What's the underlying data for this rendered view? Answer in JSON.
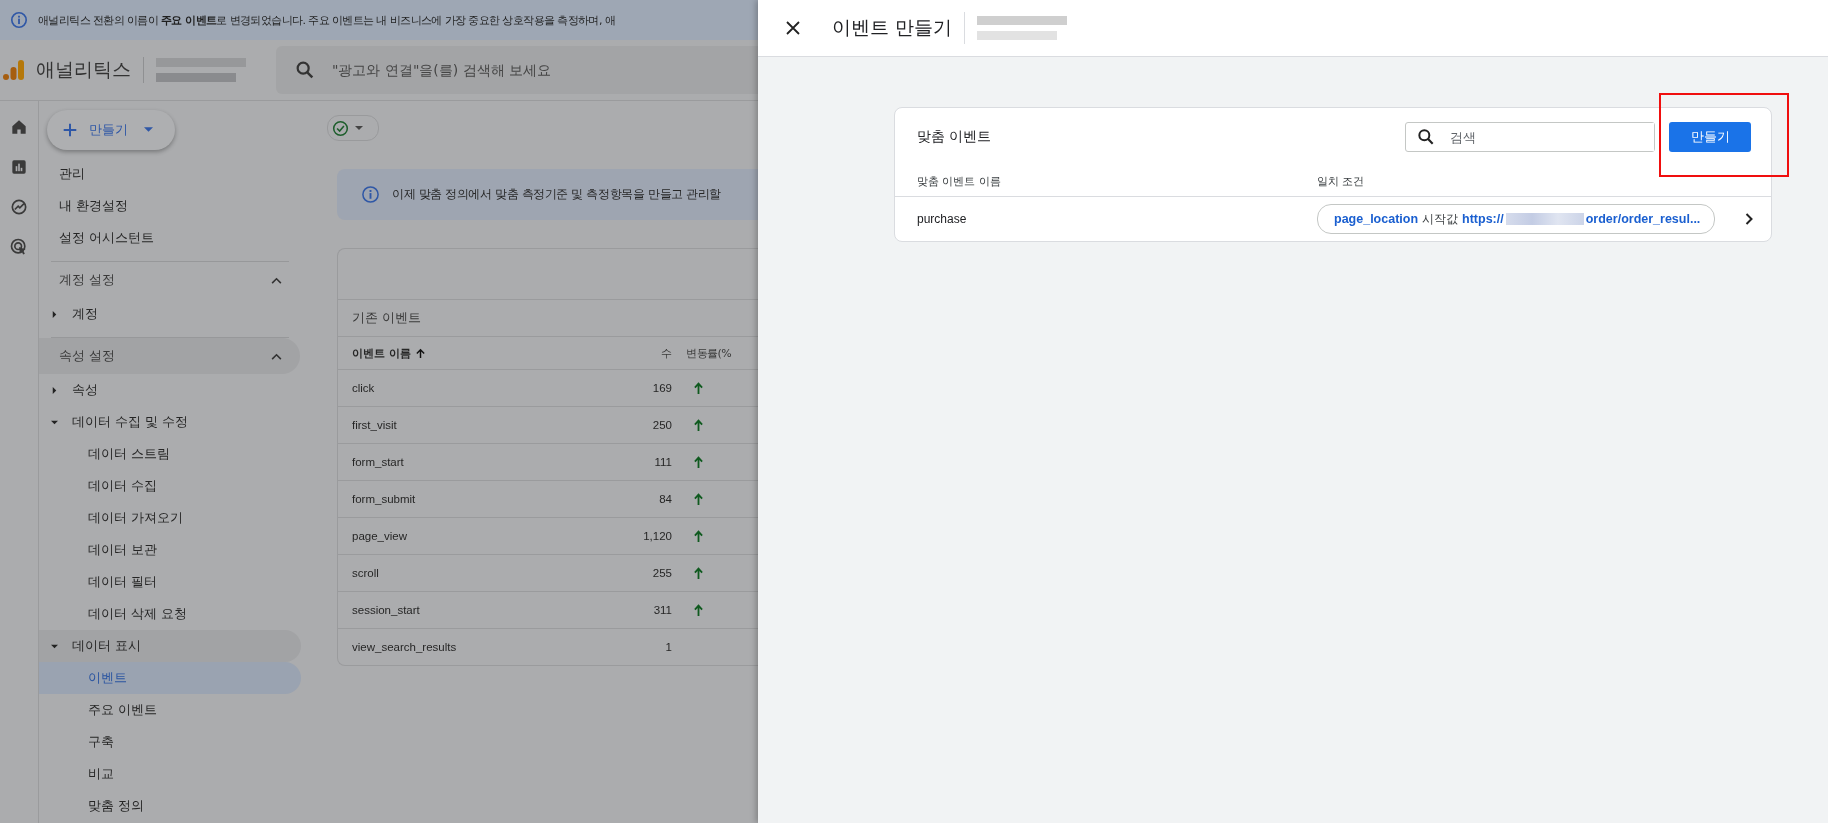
{
  "banner": {
    "text": "애널리틱스 전환의 이름이 **주요 이벤트**로 변경되었습니다. 주요 이벤트는 내 비즈니스에 가장 중요한 상호작용을 측정하며, 애"
  },
  "app_bar": {
    "product": "애널리틱스",
    "search_placeholder": "\"광고와 연결\"을(를) 검색해 보세요"
  },
  "create_button": "만들기",
  "sidebar": {
    "top_items": [
      "관리",
      "내 환경설정",
      "설정 어시스턴트"
    ],
    "sections": [
      {
        "title": "계정 설정",
        "expanded": true,
        "items": [
          {
            "label": "계정",
            "expanded": false
          }
        ]
      },
      {
        "title": "속성 설정",
        "expanded": true,
        "items": [
          {
            "label": "속성",
            "expanded": false
          },
          {
            "label": "데이터 수집 및 수정",
            "expanded": true,
            "children": [
              {
                "label": "데이터 스트림",
                "selected": false
              },
              {
                "label": "데이터 수집",
                "selected": false
              },
              {
                "label": "데이터 가져오기",
                "selected": false
              },
              {
                "label": "데이터 보관",
                "selected": false
              },
              {
                "label": "데이터 필터",
                "selected": false
              },
              {
                "label": "데이터 삭제 요청",
                "selected": false
              }
            ]
          },
          {
            "label": "데이터 표시",
            "expanded": true,
            "children": [
              {
                "label": "이벤트",
                "selected": true
              },
              {
                "label": "주요 이벤트",
                "selected": false
              },
              {
                "label": "구축",
                "selected": false
              },
              {
                "label": "비교",
                "selected": false
              },
              {
                "label": "맞춤 정의",
                "selected": false
              }
            ]
          }
        ]
      }
    ]
  },
  "info_message": "이제 맞춤 정의에서 맞춤 측정기준 및 측정항목을 만들고 관리할",
  "events_table": {
    "title": "기존 이벤트",
    "columns": [
      "이벤트 이름",
      "수",
      "변동률(%"
    ],
    "rows": [
      {
        "name": "click",
        "count": "169",
        "rising": true
      },
      {
        "name": "first_visit",
        "count": "250",
        "rising": true
      },
      {
        "name": "form_start",
        "count": "111",
        "rising": true
      },
      {
        "name": "form_submit",
        "count": "84",
        "rising": true
      },
      {
        "name": "page_view",
        "count": "1,120",
        "rising": true
      },
      {
        "name": "scroll",
        "count": "255",
        "rising": true
      },
      {
        "name": "session_start",
        "count": "311",
        "rising": true
      },
      {
        "name": "view_search_results",
        "count": "1",
        "rising": false
      }
    ]
  },
  "panel": {
    "title": "이벤트 만들기",
    "card": {
      "title": "맞춤 이벤트",
      "search_placeholder": "검색",
      "create_button": "만들기",
      "create_highlighted": true,
      "columns": [
        "맞춤 이벤트 이름",
        "일치 조건"
      ],
      "rows": [
        {
          "name": "purchase",
          "condition": {
            "parameter": "page_location",
            "operator": "시작값",
            "value_start": "https://",
            "value_end": "order/order_resul..."
          }
        }
      ]
    }
  }
}
